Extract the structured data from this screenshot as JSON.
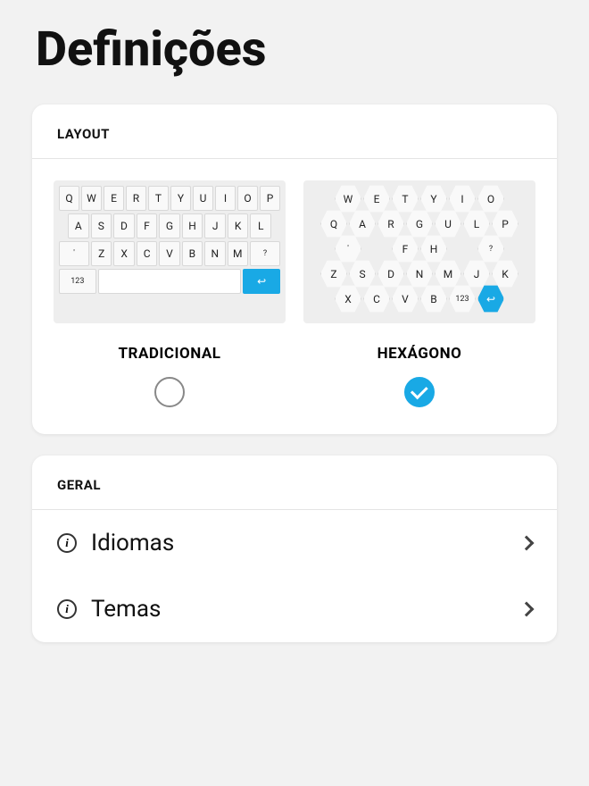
{
  "page_title": "Definições",
  "sections": {
    "layout": {
      "header": "LAYOUT",
      "options": {
        "traditional": {
          "label": "TRADICIONAL",
          "selected": false,
          "keyboard": {
            "row1": [
              "Q",
              "W",
              "E",
              "R",
              "T",
              "Y",
              "U",
              "I",
              "O",
              "P"
            ],
            "row2": [
              "A",
              "S",
              "D",
              "F",
              "G",
              "H",
              "J",
              "K",
              "L"
            ],
            "row3": [
              "'",
              "Z",
              "X",
              "C",
              "V",
              "B",
              "N",
              "M",
              "?"
            ],
            "row4_123": "123",
            "row4_enter": "↩"
          }
        },
        "hexagon": {
          "label": "HEXÁGONO",
          "selected": true,
          "keyboard": {
            "row1": [
              "W",
              "E",
              "T",
              "Y",
              "I",
              "O"
            ],
            "row2": [
              "Q",
              "A",
              "R",
              "G",
              "U",
              "L",
              "P"
            ],
            "row3": [
              "'",
              "",
              "F",
              "H",
              "",
              "?"
            ],
            "row4": [
              "Z",
              "S",
              "D",
              "N",
              "M",
              "J",
              "K"
            ],
            "row5": [
              "X",
              "C",
              "V",
              "B",
              "123",
              "↩"
            ]
          }
        }
      }
    },
    "general": {
      "header": "GERAL",
      "items": [
        {
          "label": "Idiomas"
        },
        {
          "label": "Temas"
        }
      ]
    }
  }
}
